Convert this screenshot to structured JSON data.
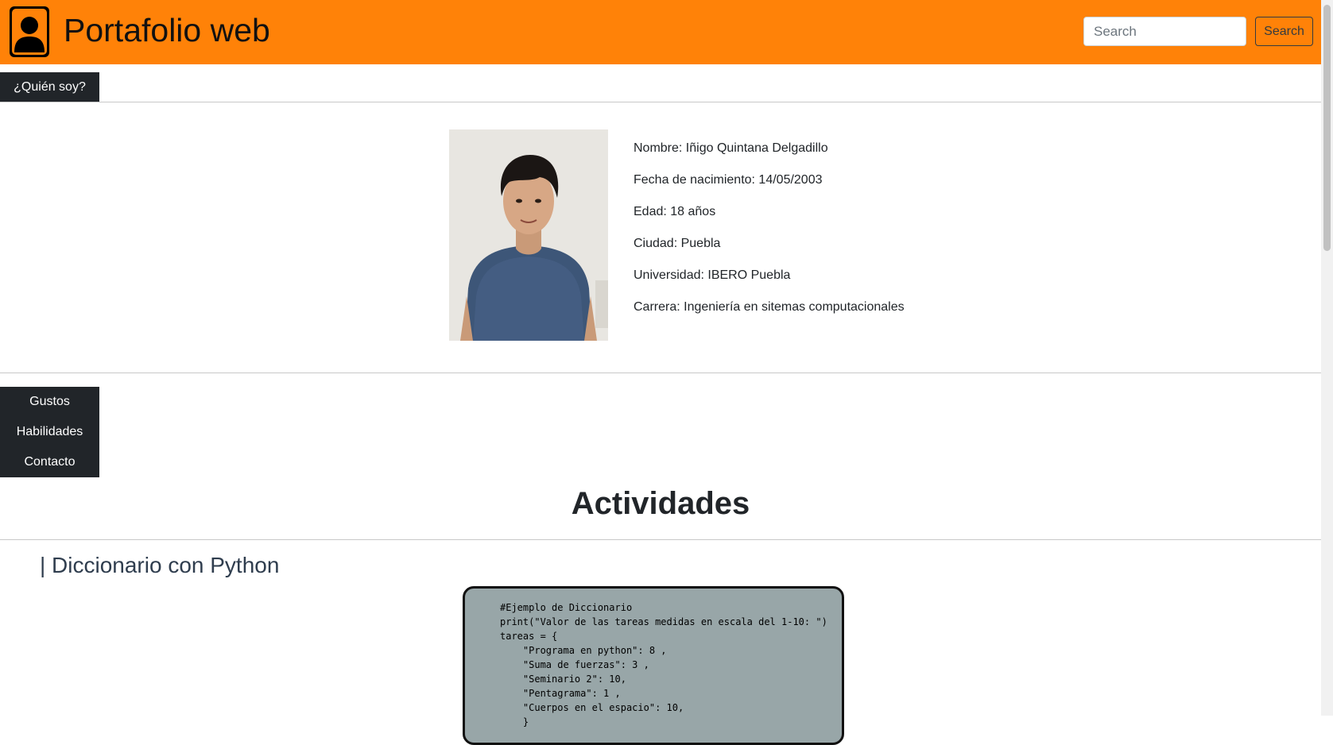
{
  "header": {
    "title": "Portafolio web",
    "search_placeholder": "Search",
    "search_button": "Search"
  },
  "about_tab": "¿Quién soy?",
  "profile": {
    "lines": [
      "Nombre: Iñigo Quintana Delgadillo",
      "Fecha de nacimiento: 14/05/2003",
      "Edad: 18 años",
      "Ciudad: Puebla",
      "Universidad: IBERO Puebla",
      "Carrera: Ingeniería en sitemas computacionales"
    ]
  },
  "side_menu": [
    "Gustos",
    "Habilidades",
    "Contacto"
  ],
  "activities": {
    "title": "Actividades",
    "subtitle": "| Diccionario con Python",
    "code": "#Ejemplo de Diccionario\nprint(\"Valor de las tareas medidas en escala del 1-10: \")\ntareas = {\n    \"Programa en python\": 8 ,\n    \"Suma de fuerzas\": 3 ,\n    \"Seminario 2\": 10,\n    \"Pentagrama\": 1 ,\n    \"Cuerpos en el espacio\": 10,\n    }"
  },
  "colors": {
    "navbar": "#ff8208",
    "dark": "#212529",
    "code_bg": "#98a6a8"
  },
  "icons": [
    "user-avatar-icon"
  ]
}
